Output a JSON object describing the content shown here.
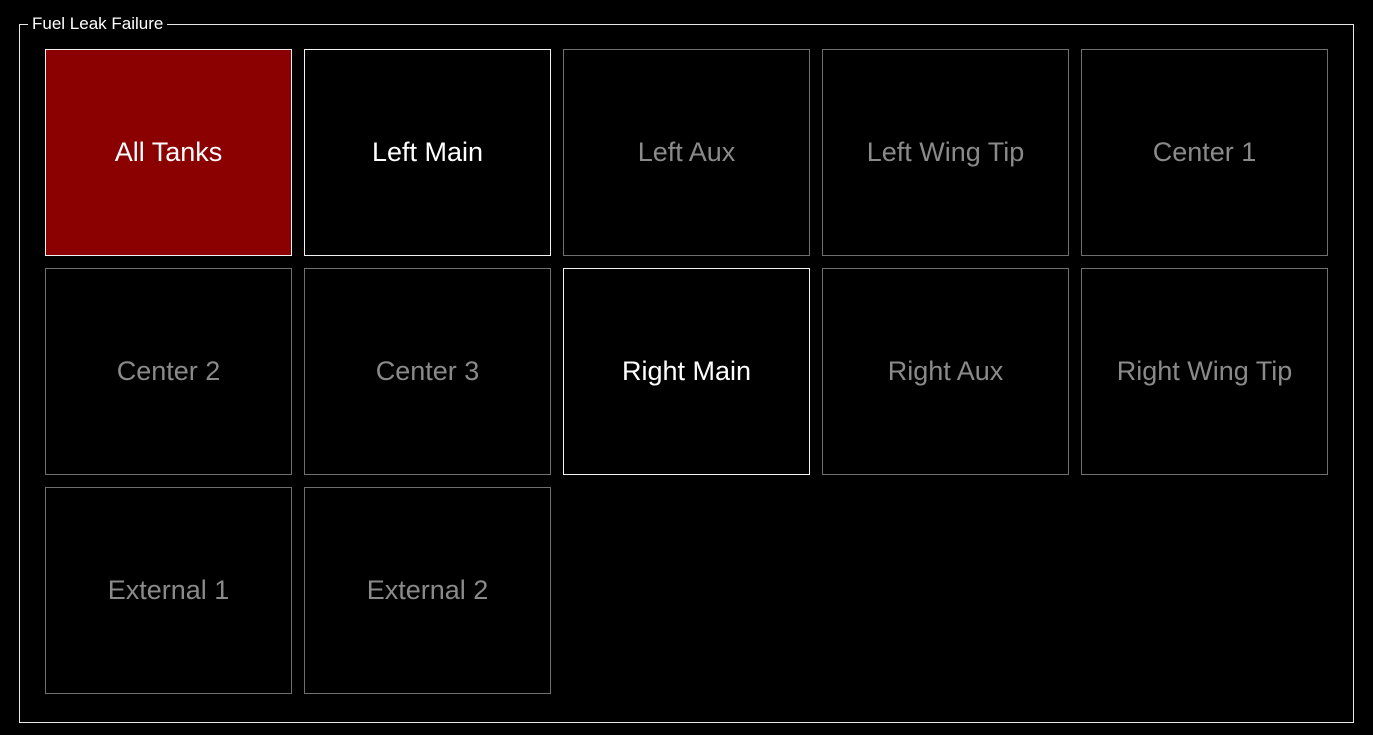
{
  "panel": {
    "title": "Fuel Leak Failure"
  },
  "colors": {
    "selected_bg": "#8b0000",
    "active_text": "#ffffff",
    "inactive_text": "#8a8a8a",
    "active_border": "#f2f2f2",
    "inactive_border": "#6f6f6f"
  },
  "tanks": [
    {
      "label": "All Tanks",
      "state": "selected"
    },
    {
      "label": "Left Main",
      "state": "active"
    },
    {
      "label": "Left Aux",
      "state": "inactive"
    },
    {
      "label": "Left Wing Tip",
      "state": "inactive"
    },
    {
      "label": "Center 1",
      "state": "inactive"
    },
    {
      "label": "Center 2",
      "state": "inactive"
    },
    {
      "label": "Center 3",
      "state": "inactive"
    },
    {
      "label": "Right Main",
      "state": "active"
    },
    {
      "label": "Right Aux",
      "state": "inactive"
    },
    {
      "label": "Right Wing Tip",
      "state": "inactive"
    },
    {
      "label": "External 1",
      "state": "inactive"
    },
    {
      "label": "External 2",
      "state": "inactive"
    }
  ]
}
